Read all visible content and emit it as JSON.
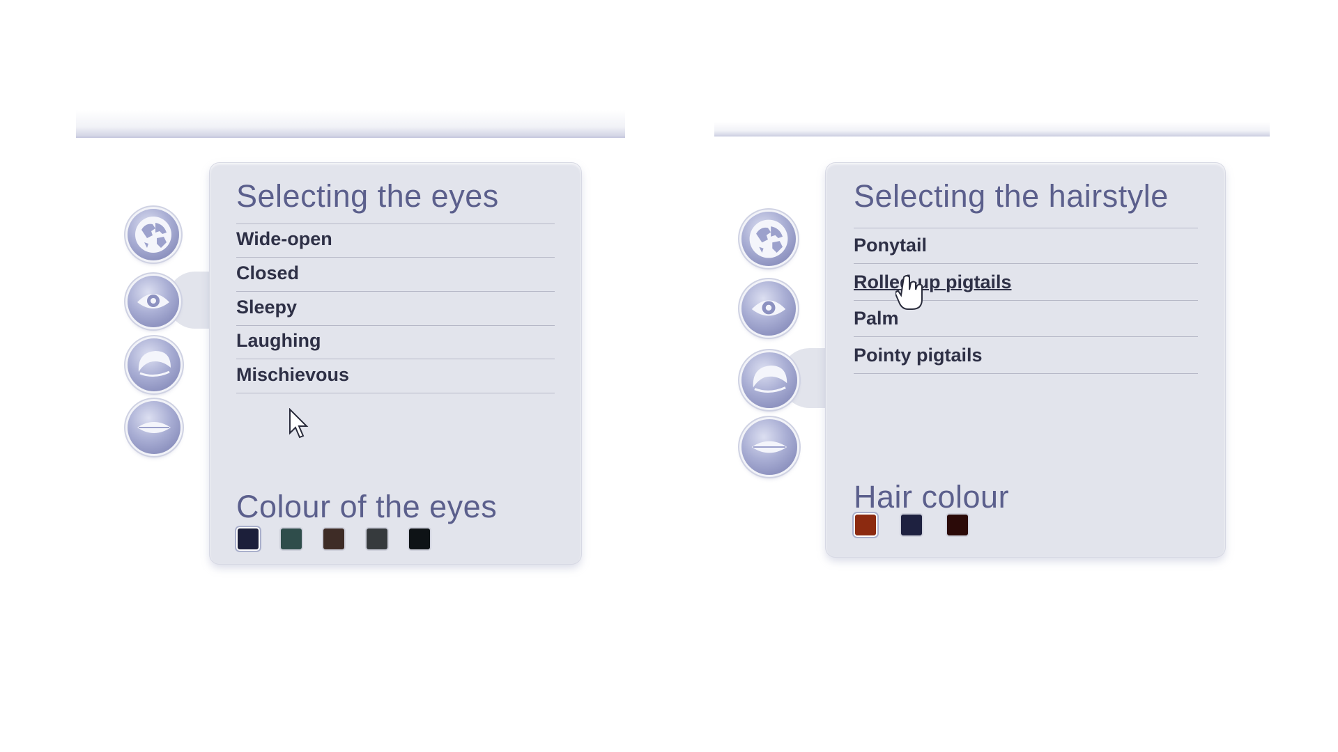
{
  "eyes_panel": {
    "title": "Selecting the eyes",
    "options": [
      {
        "label": "Wide-open"
      },
      {
        "label": "Closed"
      },
      {
        "label": "Sleepy"
      },
      {
        "label": "Laughing"
      },
      {
        "label": "Mischievous"
      }
    ],
    "colour_title": "Colour of the eyes",
    "colours": [
      "#1c1f3a",
      "#2f4d4b",
      "#3e2c26",
      "#363a3d",
      "#0e1316"
    ],
    "selected_colour_index": 0,
    "active_icon": "eye-icon",
    "cursor": "arrow-pointer"
  },
  "hair_panel": {
    "title": "Selecting the hairstyle",
    "options": [
      {
        "label": "Ponytail"
      },
      {
        "label": "Rolled-up pigtails"
      },
      {
        "label": "Palm"
      },
      {
        "label": "Pointy pigtails"
      }
    ],
    "hovered_option_index": 1,
    "colour_title": "Hair colour",
    "colours": [
      "#8c2a10",
      "#1e2140",
      "#2b0a08"
    ],
    "selected_colour_index": 0,
    "active_icon": "hair-icon",
    "cursor": "hand-pointer"
  },
  "side_icons": [
    "globe-icon",
    "eye-icon",
    "hair-icon",
    "mouth-icon"
  ]
}
